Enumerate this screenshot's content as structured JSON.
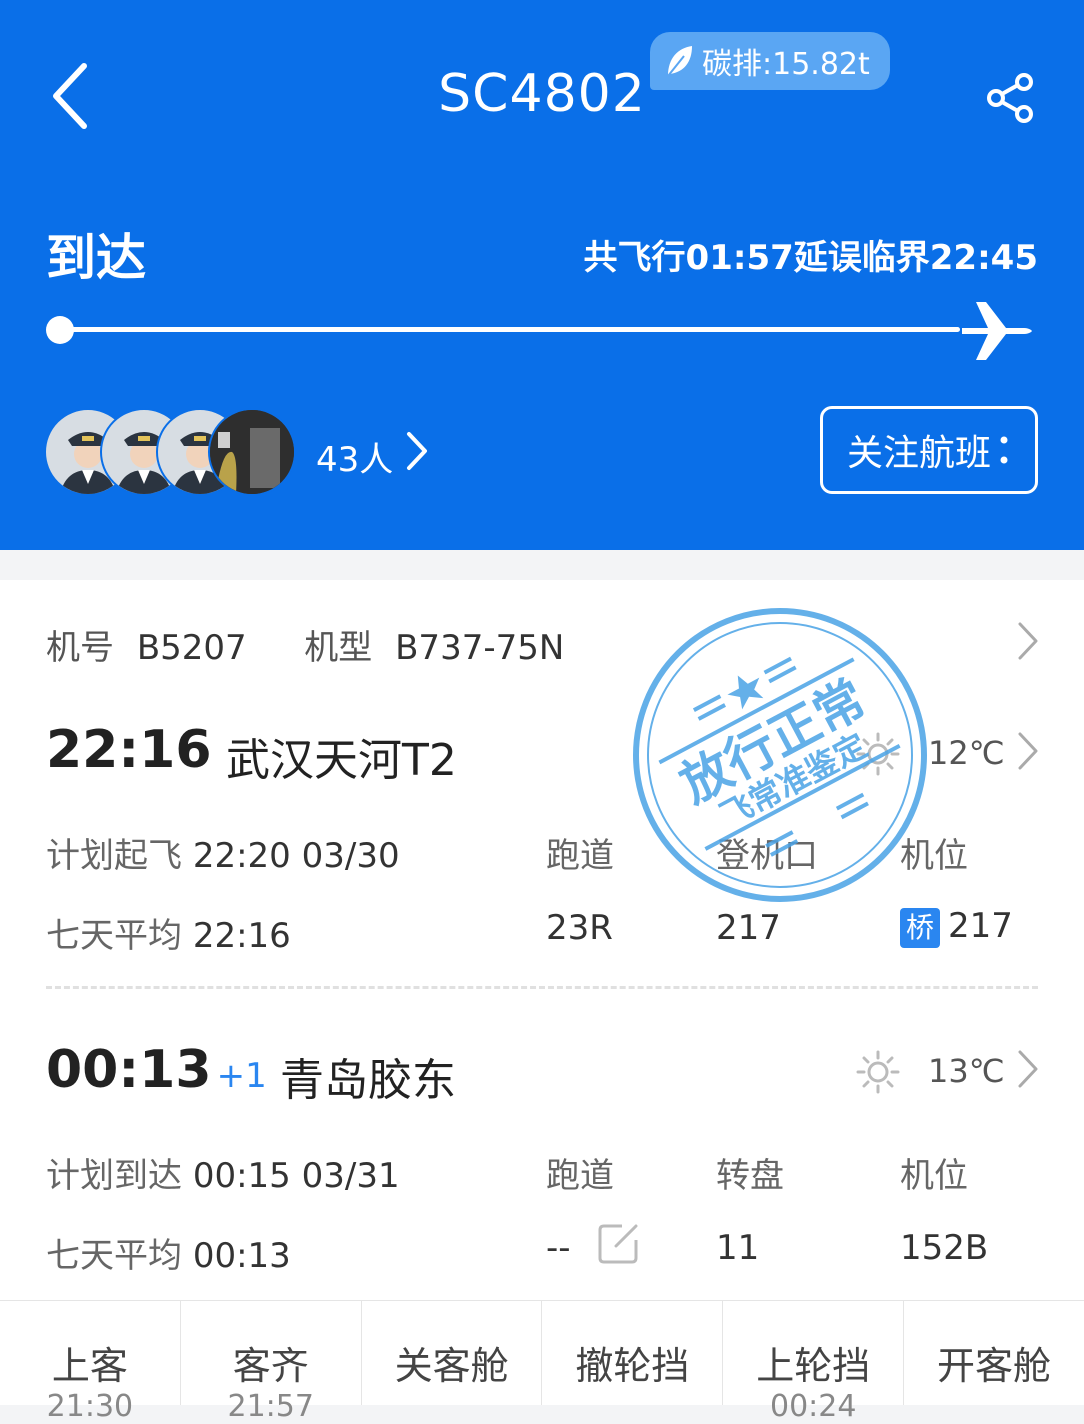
{
  "header": {
    "flight_number": "SC4802",
    "carbon_badge": "碳排:15.82t",
    "status": "到达",
    "flight_info": "共飞行01:57延误临界22:45",
    "people_count": "43人",
    "follow_label": "关注航班",
    "progress_fraction": 1.0
  },
  "aircraft": {
    "reg_label": "机号",
    "reg_value": "B5207",
    "type_label": "机型",
    "type_value": "B737-75N"
  },
  "departure": {
    "time": "22:16",
    "airport": "武汉天河T2",
    "temperature": "12℃",
    "plan_label": "计划起飞",
    "plan_value": "22:20 03/30",
    "avg_label": "七天平均",
    "avg_value": "22:16",
    "col1_label": "跑道",
    "col1_value": "23R",
    "col2_label": "登机口",
    "col2_value": "217",
    "col3_label": "机位",
    "col3_tag": "桥",
    "col3_value": "217"
  },
  "arrival": {
    "time": "00:13",
    "day_offset": "+1",
    "airport": "青岛胶东",
    "temperature": "13℃",
    "plan_label": "计划到达",
    "plan_value": "00:15 03/31",
    "avg_label": "七天平均",
    "avg_value": "00:13",
    "col1_label": "跑道",
    "col1_value": "--",
    "col2_label": "转盘",
    "col2_value": "11",
    "col3_label": "机位",
    "col3_value": "152B"
  },
  "stamp": {
    "line1": "放行正常",
    "line2": "飞常准鉴定"
  },
  "steps": [
    {
      "name": "上客",
      "time": "21:30"
    },
    {
      "name": "客齐",
      "time": "21:57"
    },
    {
      "name": "关客舱",
      "time": ""
    },
    {
      "name": "撤轮挡",
      "time": ""
    },
    {
      "name": "上轮挡",
      "time": "00:24"
    },
    {
      "name": "开客舱",
      "time": ""
    }
  ],
  "colors": {
    "brand_blue": "#0a6fe8",
    "accent_blue": "#2a86f0",
    "stamp_blue": "#4aa3e6"
  }
}
